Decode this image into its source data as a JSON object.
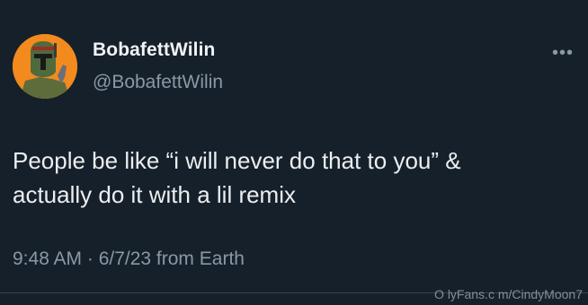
{
  "user": {
    "display_name": "BobafettWilin",
    "handle": "@BobafettWilin",
    "avatar_icon": "boba-fett-helmet-icon"
  },
  "more_icon": "•••",
  "tweet": {
    "text_line1": "People be like “i will never do that to you” &",
    "text_line2": "actually do it with a lil remix",
    "meta": "9:48 AM · 6/7/23 from Earth"
  },
  "watermark": "O lyFans.c m/CindyMoon7",
  "colors": {
    "background": "#15202b",
    "secondary_text": "#8b98a5",
    "avatar_bg": "#f28a1e"
  }
}
